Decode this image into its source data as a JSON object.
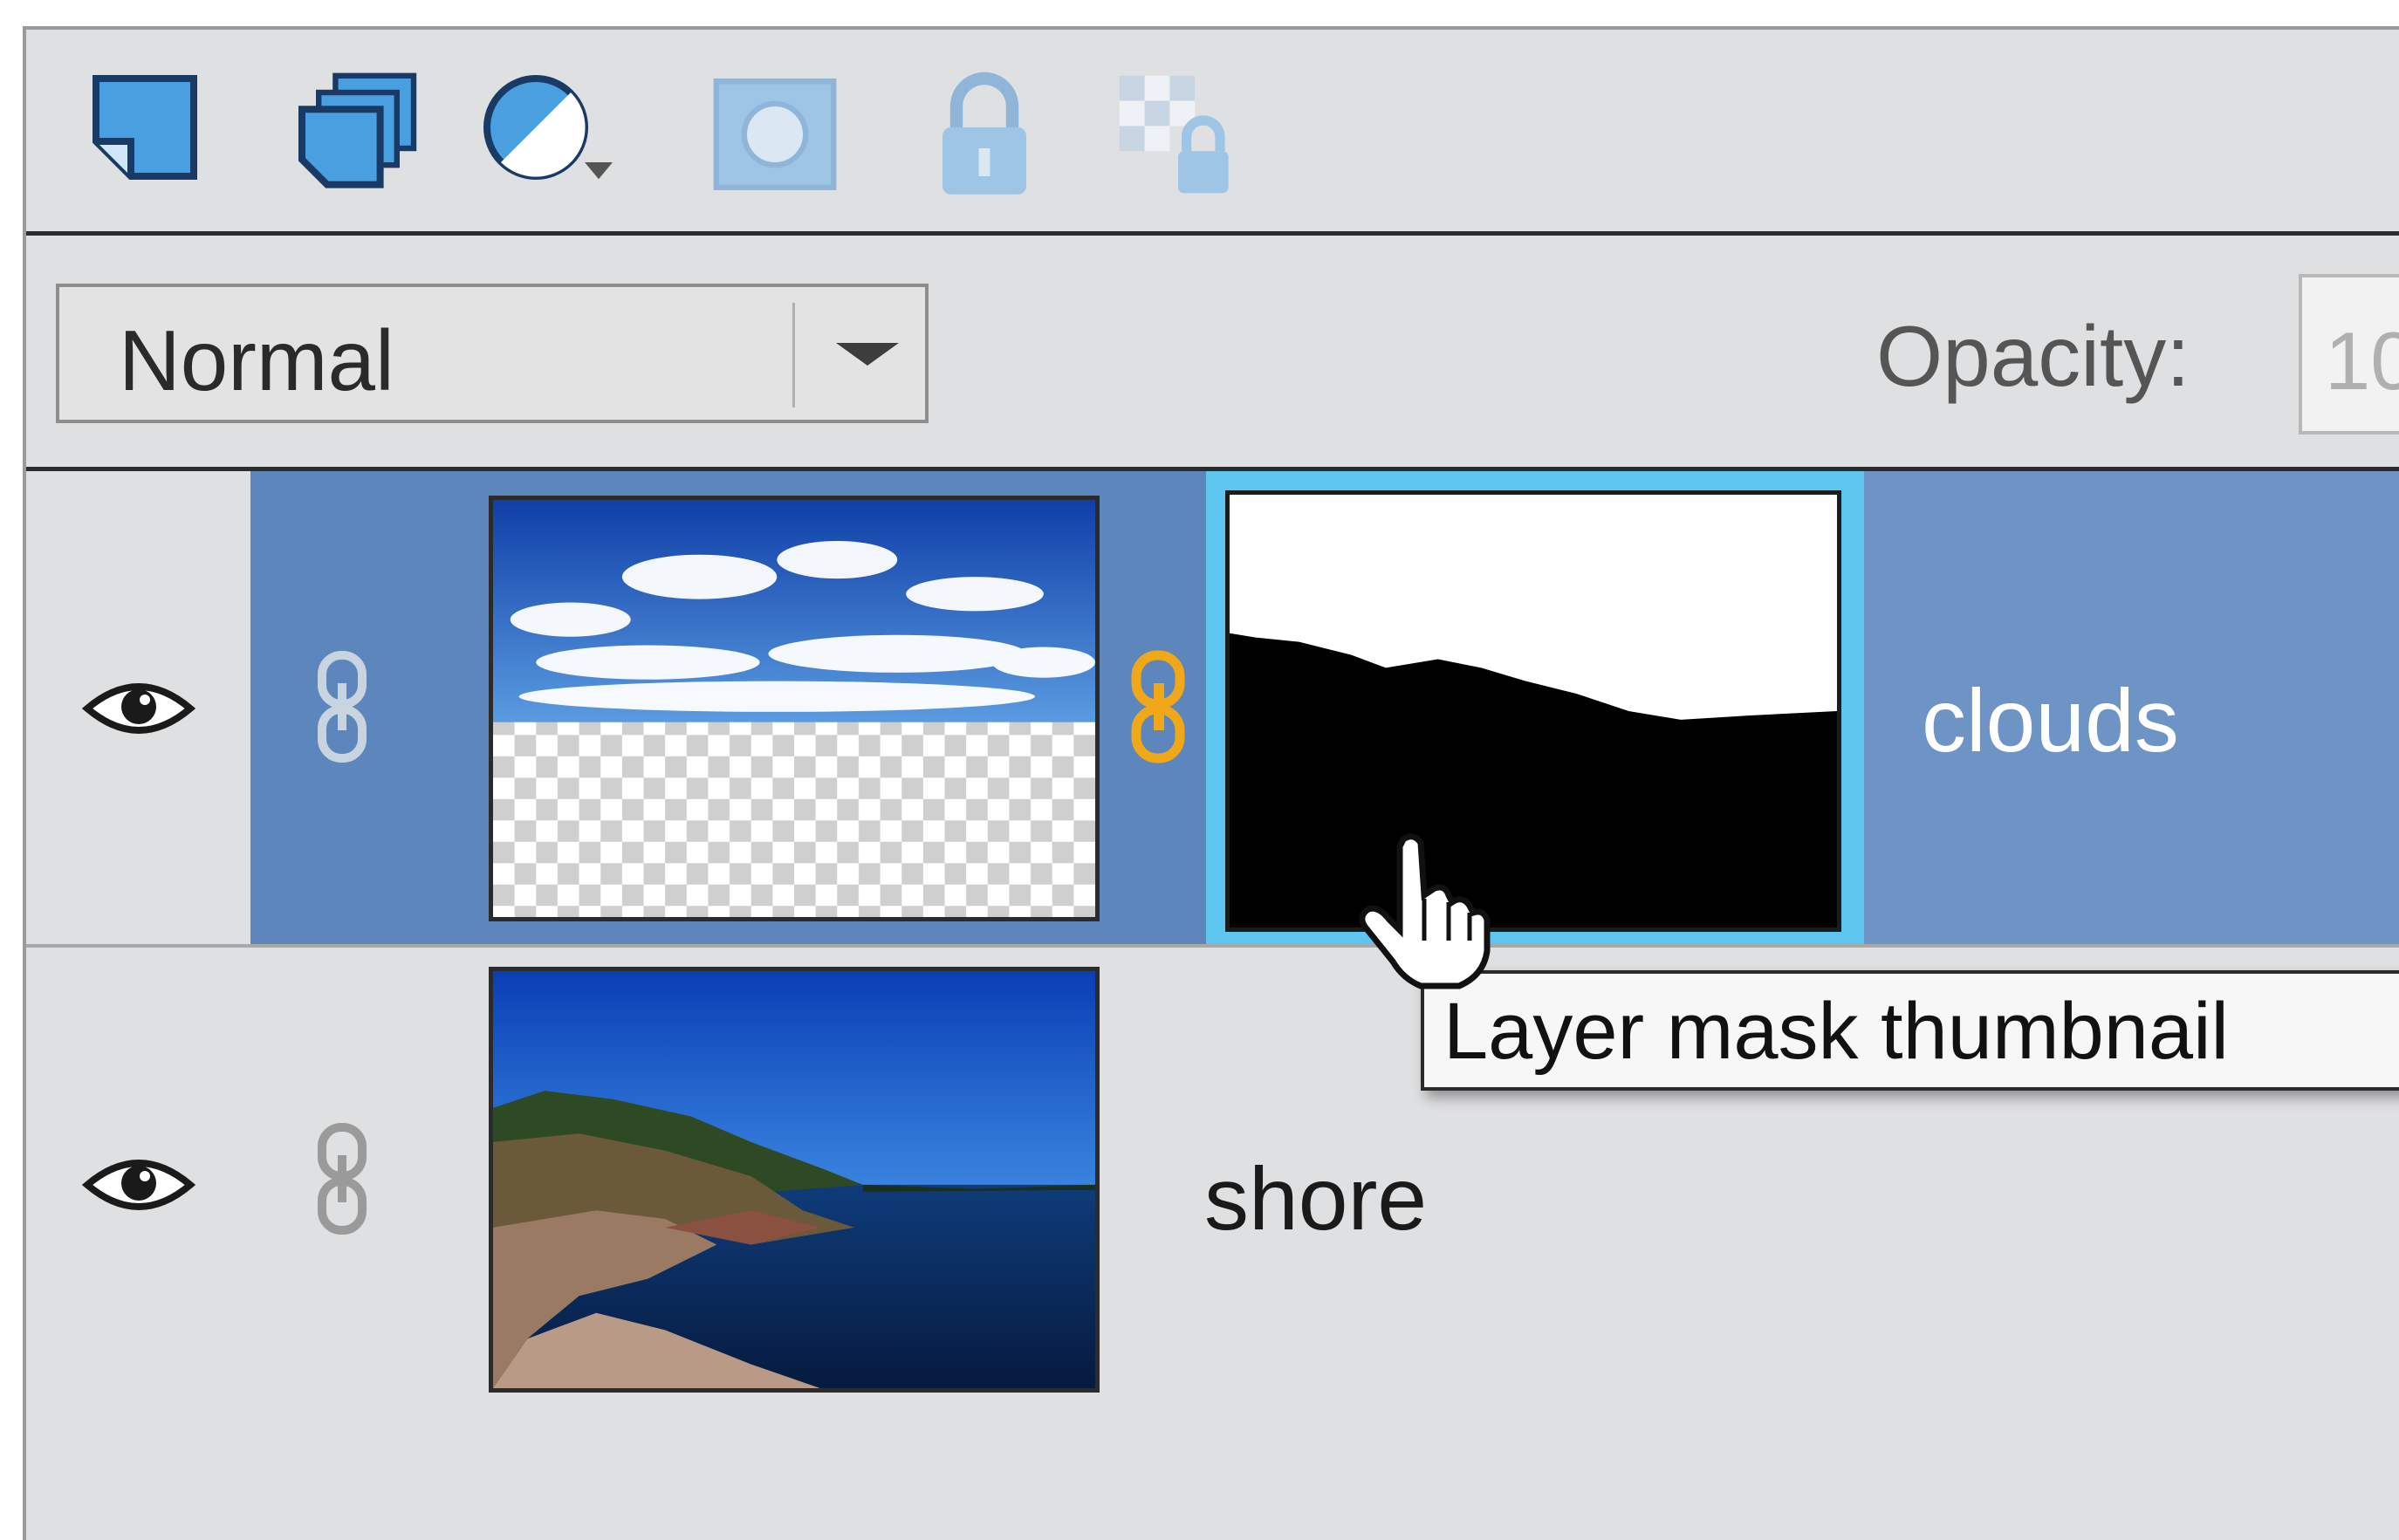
{
  "toolbar": {
    "icons": [
      "new-layer-icon",
      "new-group-icon",
      "adjustment-layer-icon",
      "add-mask-icon",
      "lock-all-icon",
      "lock-transparency-icon"
    ]
  },
  "blend": {
    "mode": "Normal",
    "opacity_label": "Opacity:",
    "opacity_value": "10"
  },
  "layers": [
    {
      "name": "clouds",
      "visible": true,
      "selected": true,
      "has_mask": true
    },
    {
      "name": "shore",
      "visible": true,
      "selected": false,
      "has_mask": false
    }
  ],
  "tooltip": {
    "text": "Layer mask thumbnail"
  },
  "colors": {
    "panel_bg": "#dfe0e1",
    "selection": "#6d94c5",
    "mask_highlight": "#5ec6ee",
    "link_active": "#f0a818"
  }
}
